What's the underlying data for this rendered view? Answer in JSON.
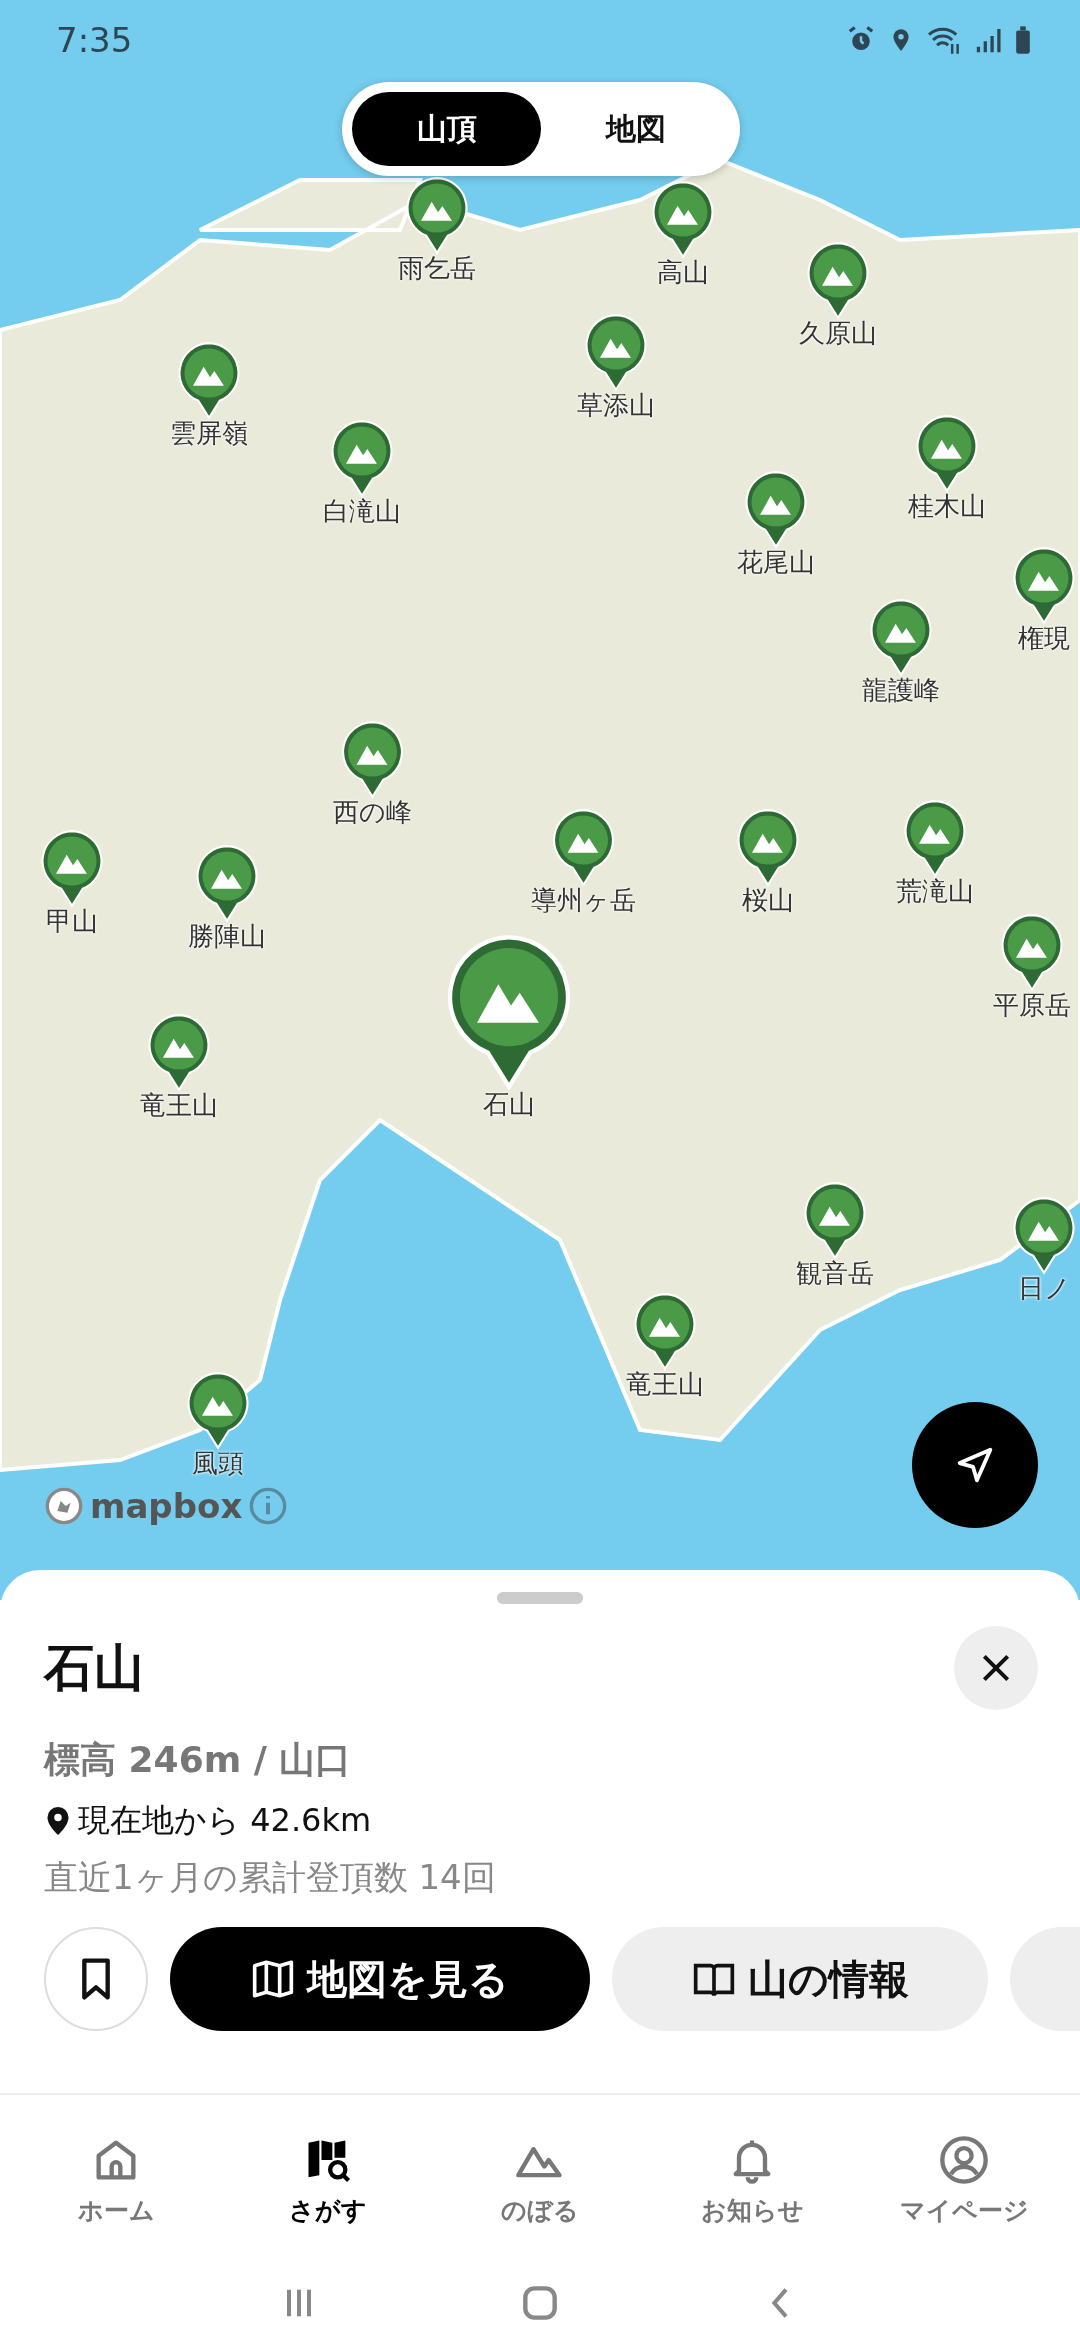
{
  "status_bar": {
    "time": "7:35"
  },
  "view_toggle": [
    {
      "label": "山頂",
      "selected": true
    },
    {
      "label": "地図",
      "selected": false
    }
  ],
  "pins": [
    {
      "name": "雨乞岳",
      "selected": false
    },
    {
      "name": "高山",
      "selected": false
    },
    {
      "name": "久原山",
      "selected": false
    },
    {
      "name": "草添山",
      "selected": false
    },
    {
      "name": "雲屏嶺",
      "selected": false
    },
    {
      "name": "白滝山",
      "selected": false
    },
    {
      "name": "桂木山",
      "selected": false
    },
    {
      "name": "花尾山",
      "selected": false
    },
    {
      "name": "権現",
      "selected": false
    },
    {
      "name": "龍護峰",
      "selected": false
    },
    {
      "name": "西の峰",
      "selected": false
    },
    {
      "name": "導州ヶ岳",
      "selected": false
    },
    {
      "name": "桜山",
      "selected": false
    },
    {
      "name": "荒滝山",
      "selected": false
    },
    {
      "name": "甲山",
      "selected": false
    },
    {
      "name": "勝陣山",
      "selected": false
    },
    {
      "name": "平原岳",
      "selected": false
    },
    {
      "name": "竜王山",
      "selected": false
    },
    {
      "name": "石山",
      "selected": true
    },
    {
      "name": "観音岳",
      "selected": false
    },
    {
      "name": "日ノ",
      "selected": false
    },
    {
      "name": "竜王山",
      "selected": false
    },
    {
      "name": "風頭",
      "selected": false
    }
  ],
  "map_attribution": "mapbox",
  "sheet": {
    "title": "石山",
    "elevation": "標高 246m / 山口",
    "distance": "現在地から 42.6km",
    "climbs": "直近1ヶ月の累計登頂数 14回",
    "actions": [
      {
        "kind": "bookmark"
      },
      {
        "kind": "primary",
        "label": "地図を見る"
      },
      {
        "kind": "secondary",
        "label": "山の情報"
      },
      {
        "kind": "more"
      }
    ]
  },
  "nav": [
    {
      "label": "ホーム",
      "selected": false
    },
    {
      "label": "さがす",
      "selected": true
    },
    {
      "label": "のぼる",
      "selected": false
    },
    {
      "label": "お知らせ",
      "selected": false
    },
    {
      "label": "マイページ",
      "selected": false
    }
  ]
}
